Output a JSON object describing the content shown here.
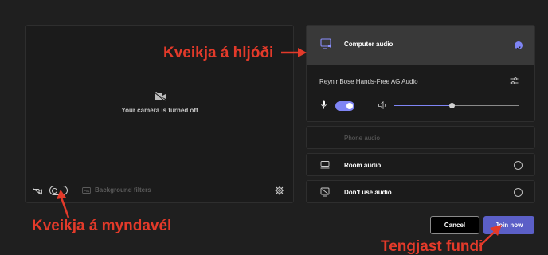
{
  "camera": {
    "status_text": "Your camera is turned off",
    "background_filters_label": "Background filters",
    "camera_toggle_on": false
  },
  "audio": {
    "computer_audio_label": "Computer audio",
    "device_name": "Reynir Bose Hands-Free AG Audio",
    "mic_on": true,
    "speaker_volume": 0.46,
    "phone_audio_label": "Phone audio",
    "room_audio_label": "Room audio",
    "no_audio_label": "Don't use audio",
    "selected": "computer"
  },
  "actions": {
    "cancel_label": "Cancel",
    "join_label": "Join now"
  },
  "annotations": {
    "audio": "Kveikja á hljóði",
    "camera": "Kveikja á myndavél",
    "join": "Tengjast fundi"
  },
  "colors": {
    "accent": "#7f85f5",
    "join_button": "#5b5fc7",
    "annotation": "#e33a2a"
  }
}
